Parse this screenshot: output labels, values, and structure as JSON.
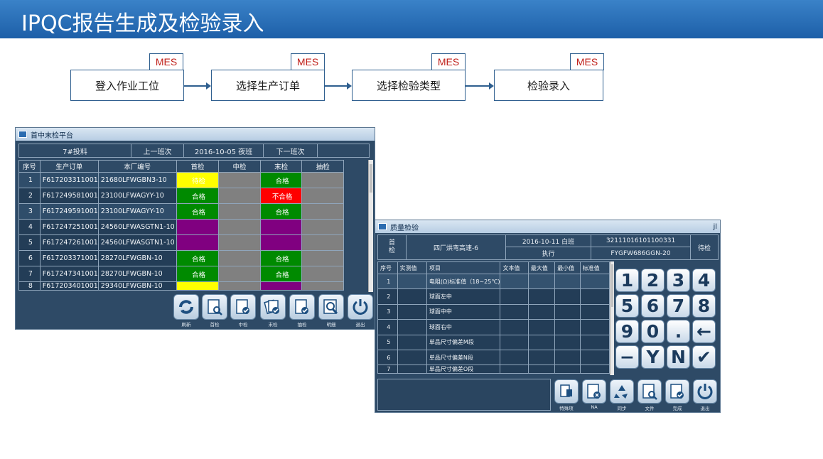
{
  "slide": {
    "title": "IPQC报告生成及检验录入"
  },
  "flow": {
    "tag": "MES",
    "steps": [
      "登入作业工位",
      "选择生产订单",
      "选择检验类型",
      "检验录入"
    ]
  },
  "win1": {
    "title": "首中末检平台",
    "info": {
      "line": "7#投料",
      "prev": "上一班次",
      "date": "2016-10-05 夜班",
      "next": "下一班次"
    },
    "headers": [
      "序号",
      "生产订单",
      "本厂编号",
      "首检",
      "中检",
      "末检",
      "抽检"
    ],
    "rows": [
      {
        "no": "1",
        "order": "F617203311001",
        "code": "21680LFWGBN3-10",
        "first": "待检",
        "fc": "yellow",
        "mid": "",
        "mc": "gray",
        "last": "合格",
        "lc": "green",
        "samp": "",
        "sc": "gray"
      },
      {
        "no": "2",
        "order": "F617249581001",
        "code": "23100LFWAGYY-10",
        "first": "合格",
        "fc": "green",
        "mid": "",
        "mc": "gray",
        "last": "不合格",
        "lc": "red",
        "samp": "",
        "sc": "gray"
      },
      {
        "no": "3",
        "order": "F617249591001",
        "code": "23100LFWAGYY-10",
        "first": "合格",
        "fc": "green",
        "mid": "",
        "mc": "gray",
        "last": "合格",
        "lc": "green",
        "samp": "",
        "sc": "gray"
      },
      {
        "no": "4",
        "order": "F617247251001",
        "code": "24560LFWASGTN1-10",
        "first": "",
        "fc": "purple",
        "mid": "",
        "mc": "gray",
        "last": "",
        "lc": "purple",
        "samp": "",
        "sc": "gray"
      },
      {
        "no": "5",
        "order": "F617247261001",
        "code": "24560LFWASGTN1-10",
        "first": "",
        "fc": "purple",
        "mid": "",
        "mc": "gray",
        "last": "",
        "lc": "purple",
        "samp": "",
        "sc": "gray"
      },
      {
        "no": "6",
        "order": "F617203371001",
        "code": "28270LFWGBN-10",
        "first": "合格",
        "fc": "green",
        "mid": "",
        "mc": "gray",
        "last": "合格",
        "lc": "green",
        "samp": "",
        "sc": "gray"
      },
      {
        "no": "7",
        "order": "F617247341001",
        "code": "28270LFWGBN-10",
        "first": "合格",
        "fc": "green",
        "mid": "",
        "mc": "gray",
        "last": "合格",
        "lc": "green",
        "samp": "",
        "sc": "gray"
      },
      {
        "no": "8",
        "order": "F617203401001",
        "code": "29340LFWGBN-10",
        "first": "",
        "fc": "yellow",
        "mid": "",
        "mc": "gray",
        "last": "",
        "lc": "purple",
        "samp": "",
        "sc": "gray"
      }
    ],
    "toolbar": [
      "刷新",
      "首检",
      "中检",
      "末检",
      "抽检",
      "明细",
      "退出"
    ]
  },
  "win2": {
    "title": "质量检验",
    "corner": "jl",
    "info": {
      "type": "首\n检",
      "line": "四厂烘弯高速-6",
      "date": "2016-10-11 白班",
      "status": "执行",
      "serial": "32111016101100331",
      "part": "FYGFW686GGN-20",
      "state": "待检"
    },
    "headers": [
      "序号",
      "实测值",
      "项目",
      "文本值",
      "最大值",
      "最小值",
      "标准值"
    ],
    "rows": [
      {
        "no": "1",
        "item": "电阻(Ω)标准值（18~25℃)"
      },
      {
        "no": "2",
        "item": "球面左中"
      },
      {
        "no": "3",
        "item": "球面中中"
      },
      {
        "no": "4",
        "item": "球面右中"
      },
      {
        "no": "5",
        "item": "单品尺寸偏差M段"
      },
      {
        "no": "6",
        "item": "单品尺寸偏差N段"
      },
      {
        "no": "7",
        "item": "单品尺寸偏差O段"
      }
    ],
    "keypad": [
      "1",
      "2",
      "3",
      "4",
      "5",
      "6",
      "7",
      "8",
      "9",
      "0",
      ".",
      "←",
      "−",
      "Y",
      "N",
      "✔"
    ],
    "toolbar": [
      "特殊项",
      "NA",
      "同步",
      "文件",
      "完成",
      "退出"
    ]
  }
}
